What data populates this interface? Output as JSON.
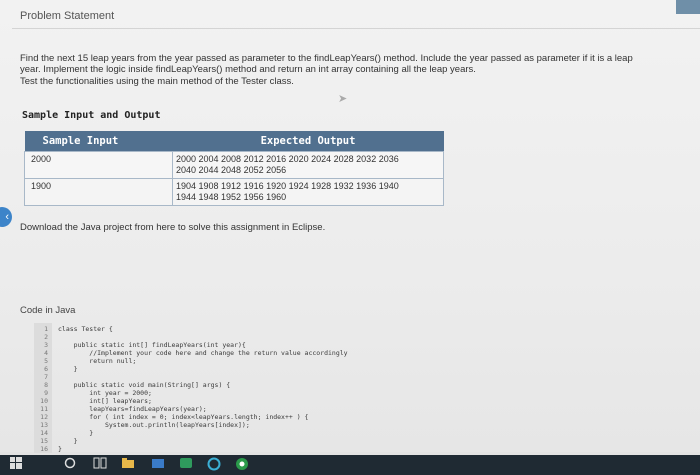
{
  "problem": {
    "section_title": "Problem Statement",
    "line1": "Find the next 15 leap years from the year passed as parameter to the findLeapYears() method. Include the year passed as parameter if it is a leap",
    "line2": "year. Implement the logic inside findLeapYears() method and return an int array containing all the leap years.",
    "line3": "Test the functionalities using the main method of the Tester class."
  },
  "sample": {
    "heading": "Sample Input and Output",
    "col_input": "Sample Input",
    "col_output": "Expected Output",
    "rows": [
      {
        "input": "2000",
        "output_l1": "2000 2004 2008 2012 2016 2020 2024 2028 2032 2036",
        "output_l2": "2040 2044 2048 2052 2056"
      },
      {
        "input": "1900",
        "output_l1": "1904 1908 1912 1916 1920 1924 1928 1932 1936 1940",
        "output_l2": "1944 1948 1952 1956 1960"
      }
    ]
  },
  "download_text": "Download the Java project from here to solve this assignment in Eclipse.",
  "code": {
    "label": "Code in Java",
    "lines": [
      {
        "n": "1",
        "text": "class Tester {"
      },
      {
        "n": "2",
        "text": ""
      },
      {
        "n": "3",
        "text": "    public static int[] findLeapYears(int year){"
      },
      {
        "n": "4",
        "text": "        //Implement your code here and change the return value accordingly"
      },
      {
        "n": "5",
        "text": "        return null;"
      },
      {
        "n": "6",
        "text": "    }"
      },
      {
        "n": "7",
        "text": ""
      },
      {
        "n": "8",
        "text": "    public static void main(String[] args) {"
      },
      {
        "n": "9",
        "text": "        int year = 2000;"
      },
      {
        "n": "10",
        "text": "        int[] leapYears;"
      },
      {
        "n": "11",
        "text": "        leapYears=findLeapYears(year);"
      },
      {
        "n": "12",
        "text": "        for ( int index = 0; index<leapYears.length; index++ ) {"
      },
      {
        "n": "13",
        "text": "            System.out.println(leapYears[index]);"
      },
      {
        "n": "14",
        "text": "        }"
      },
      {
        "n": "15",
        "text": "    }"
      },
      {
        "n": "16",
        "text": "}"
      }
    ]
  },
  "taskbar": {
    "items": [
      "windows-icon",
      "search-icon",
      "task-view-icon",
      "file-explorer-icon",
      "store-icon",
      "app-icon",
      "edge-icon",
      "chrome-icon"
    ]
  },
  "colors": {
    "table_header": "#51708f",
    "accent_arrow": "#3d84c9",
    "taskbar": "#1f2a33"
  }
}
